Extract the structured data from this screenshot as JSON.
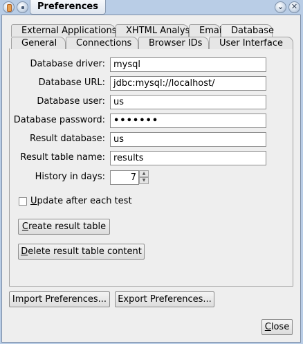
{
  "window": {
    "title": "Preferences"
  },
  "tabs": {
    "row1": [
      "External Applications",
      "XHTML Analysis",
      "Email",
      "Database"
    ],
    "row2": [
      "General",
      "Connections",
      "Browser IDs",
      "User Interface"
    ],
    "active": "Database"
  },
  "form": {
    "driver_label": "Database driver:",
    "driver_value": "mysql",
    "url_label": "Database URL:",
    "url_value": "jdbc:mysql://localhost/",
    "user_label": "Database user:",
    "user_value": "us",
    "password_label": "Database password:",
    "password_value": "•••••••",
    "result_db_label": "Result database:",
    "result_db_value": "us",
    "result_table_label": "Result table name:",
    "result_table_value": "results",
    "history_label": "History in days:",
    "history_value": "7",
    "update_first": "U",
    "update_rest": "pdate after each test",
    "update_checked": false
  },
  "buttons": {
    "create_first": "C",
    "create_rest": "reate result table",
    "delete_first": "D",
    "delete_rest": "elete result table content",
    "import": "Import Preferences...",
    "export": "Export Preferences...",
    "close_first": "C",
    "close_rest": "lose"
  }
}
